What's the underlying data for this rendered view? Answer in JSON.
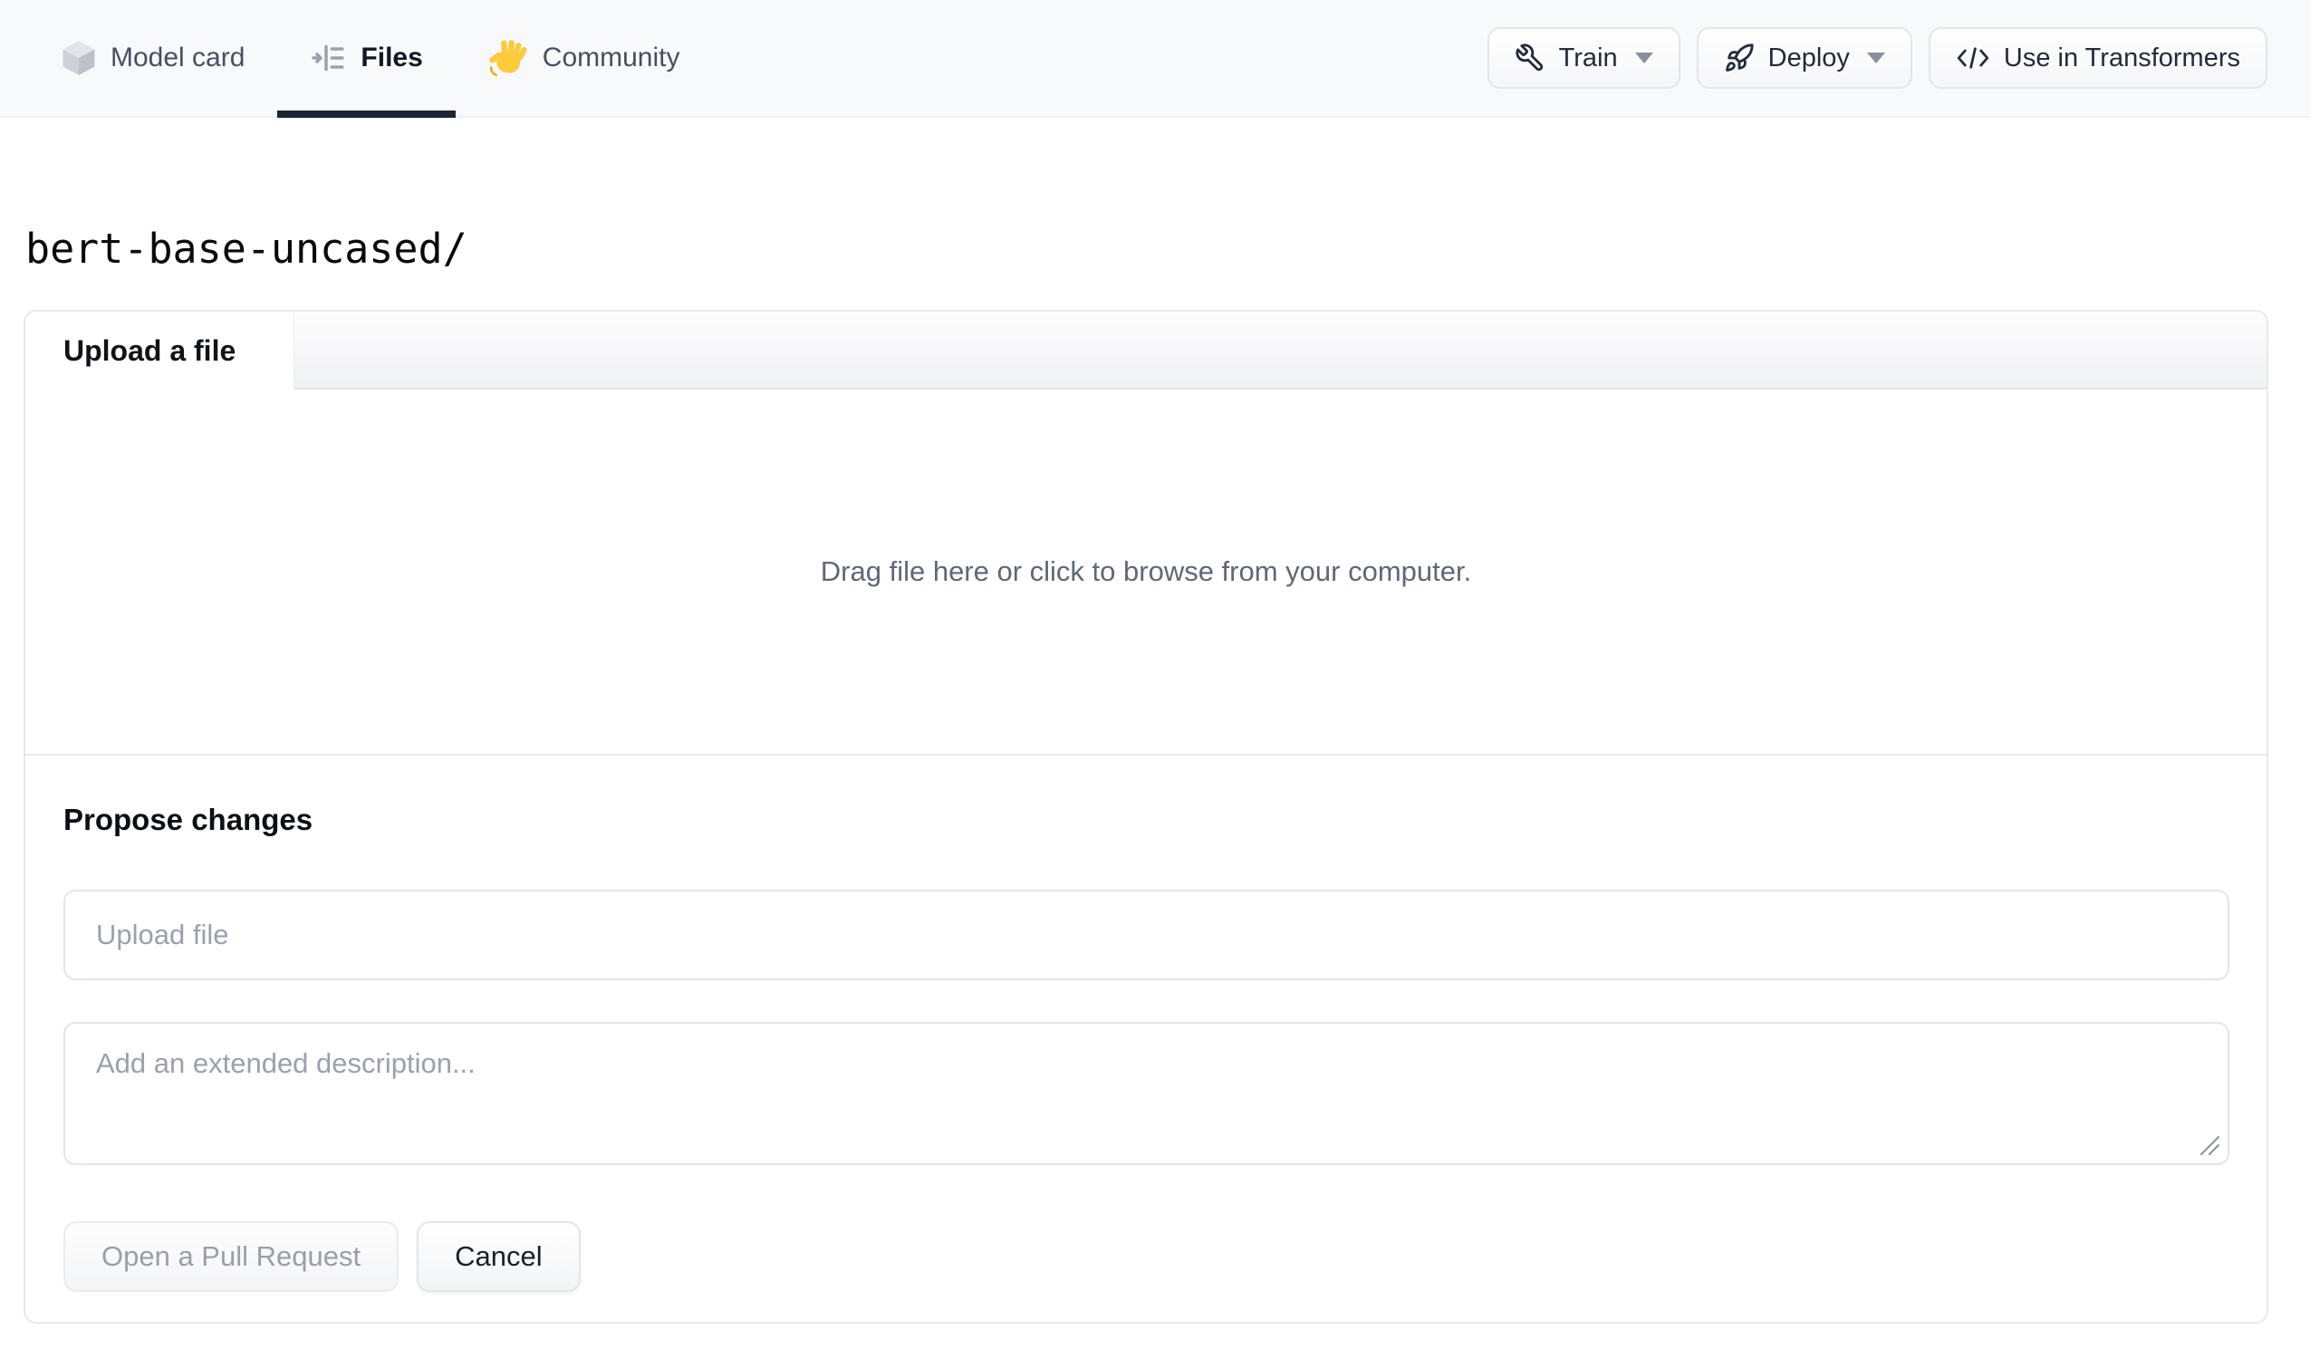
{
  "header": {
    "tabs": [
      {
        "label": "Model card",
        "icon": "cube-icon",
        "active": false
      },
      {
        "label": "Files",
        "icon": "file-versions-icon",
        "active": true
      },
      {
        "label": "Community",
        "icon": "waving-hand-icon",
        "active": false
      }
    ],
    "actions": [
      {
        "label": "Train",
        "icon": "wrench-icon",
        "has_dropdown": true
      },
      {
        "label": "Deploy",
        "icon": "rocket-icon",
        "has_dropdown": true
      },
      {
        "label": "Use in Transformers",
        "icon": "code-icon",
        "has_dropdown": false
      }
    ]
  },
  "repo": {
    "path": "bert-base-uncased/"
  },
  "upload": {
    "tab_label": "Upload a file",
    "dropzone_text": "Drag file here or click to browse from your computer.",
    "propose_heading": "Propose changes",
    "file_placeholder": "Upload file",
    "description_placeholder": "Add an extended description...",
    "open_pr_label": "Open a Pull Request",
    "cancel_label": "Cancel"
  },
  "colors": {
    "header_bg": "#f8f9fb",
    "active_tab_indicator": "#1b2533",
    "hand_emoji_yellow": "#ffc93c",
    "border_gray": "#e7e9ed",
    "placeholder_gray": "#99a1ae"
  }
}
